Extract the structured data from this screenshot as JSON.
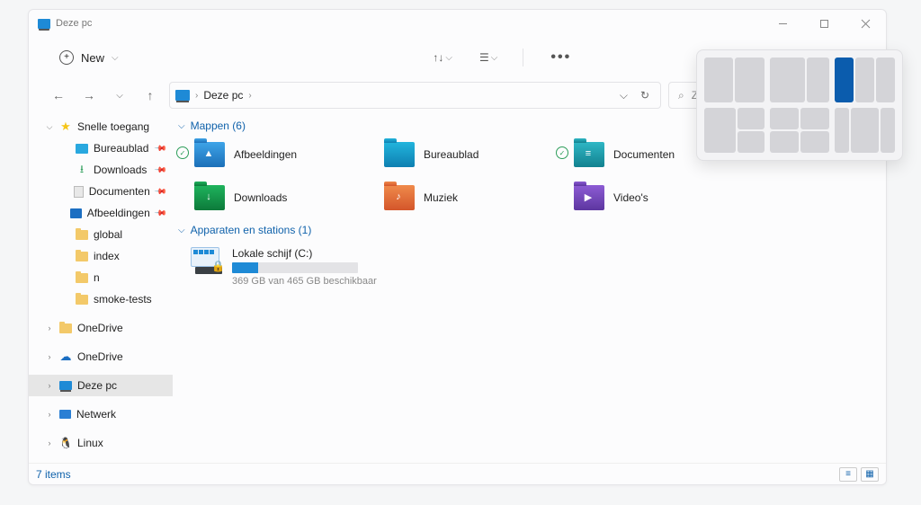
{
  "window": {
    "title": "Deze pc"
  },
  "toolbar": {
    "new_label": "New"
  },
  "breadcrumb": {
    "root": "Deze pc"
  },
  "search": {
    "placeholder": "Zoeken in Deze pc"
  },
  "sidebar": {
    "quick_access": "Snelle toegang",
    "quick_items": [
      {
        "label": "Bureaublad",
        "kind": "desk"
      },
      {
        "label": "Downloads",
        "kind": "dl"
      },
      {
        "label": "Documenten",
        "kind": "doc"
      },
      {
        "label": "Afbeeldingen",
        "kind": "pic"
      },
      {
        "label": "global",
        "kind": "folder"
      },
      {
        "label": "index",
        "kind": "folder"
      },
      {
        "label": "n",
        "kind": "folder"
      },
      {
        "label": "smoke-tests",
        "kind": "folder"
      }
    ],
    "onedrive1": "OneDrive",
    "onedrive2": "OneDrive",
    "this_pc": "Deze pc",
    "network": "Netwerk",
    "linux": "Linux"
  },
  "sections": {
    "folders_header": "Mappen (6)",
    "drives_header": "Apparaten en stations (1)"
  },
  "folders": [
    {
      "label": "Afbeeldingen",
      "color": "fl-blue",
      "glyph": "▲",
      "check": true
    },
    {
      "label": "Bureaublad",
      "color": "fl-cyan",
      "glyph": "",
      "check": false
    },
    {
      "label": "Documenten",
      "color": "fl-teal",
      "glyph": "≡",
      "check": true
    },
    {
      "label": "Downloads",
      "color": "fl-green",
      "glyph": "↓",
      "check": false
    },
    {
      "label": "Muziek",
      "color": "fl-orange",
      "glyph": "♪",
      "check": false
    },
    {
      "label": "Video's",
      "color": "fl-purple",
      "glyph": "▶",
      "check": false
    }
  ],
  "drive": {
    "label": "Lokale schijf (C:)",
    "sub": "369 GB van 465 GB beschikbaar",
    "used_pct": 21
  },
  "status": {
    "count": "7 items"
  }
}
